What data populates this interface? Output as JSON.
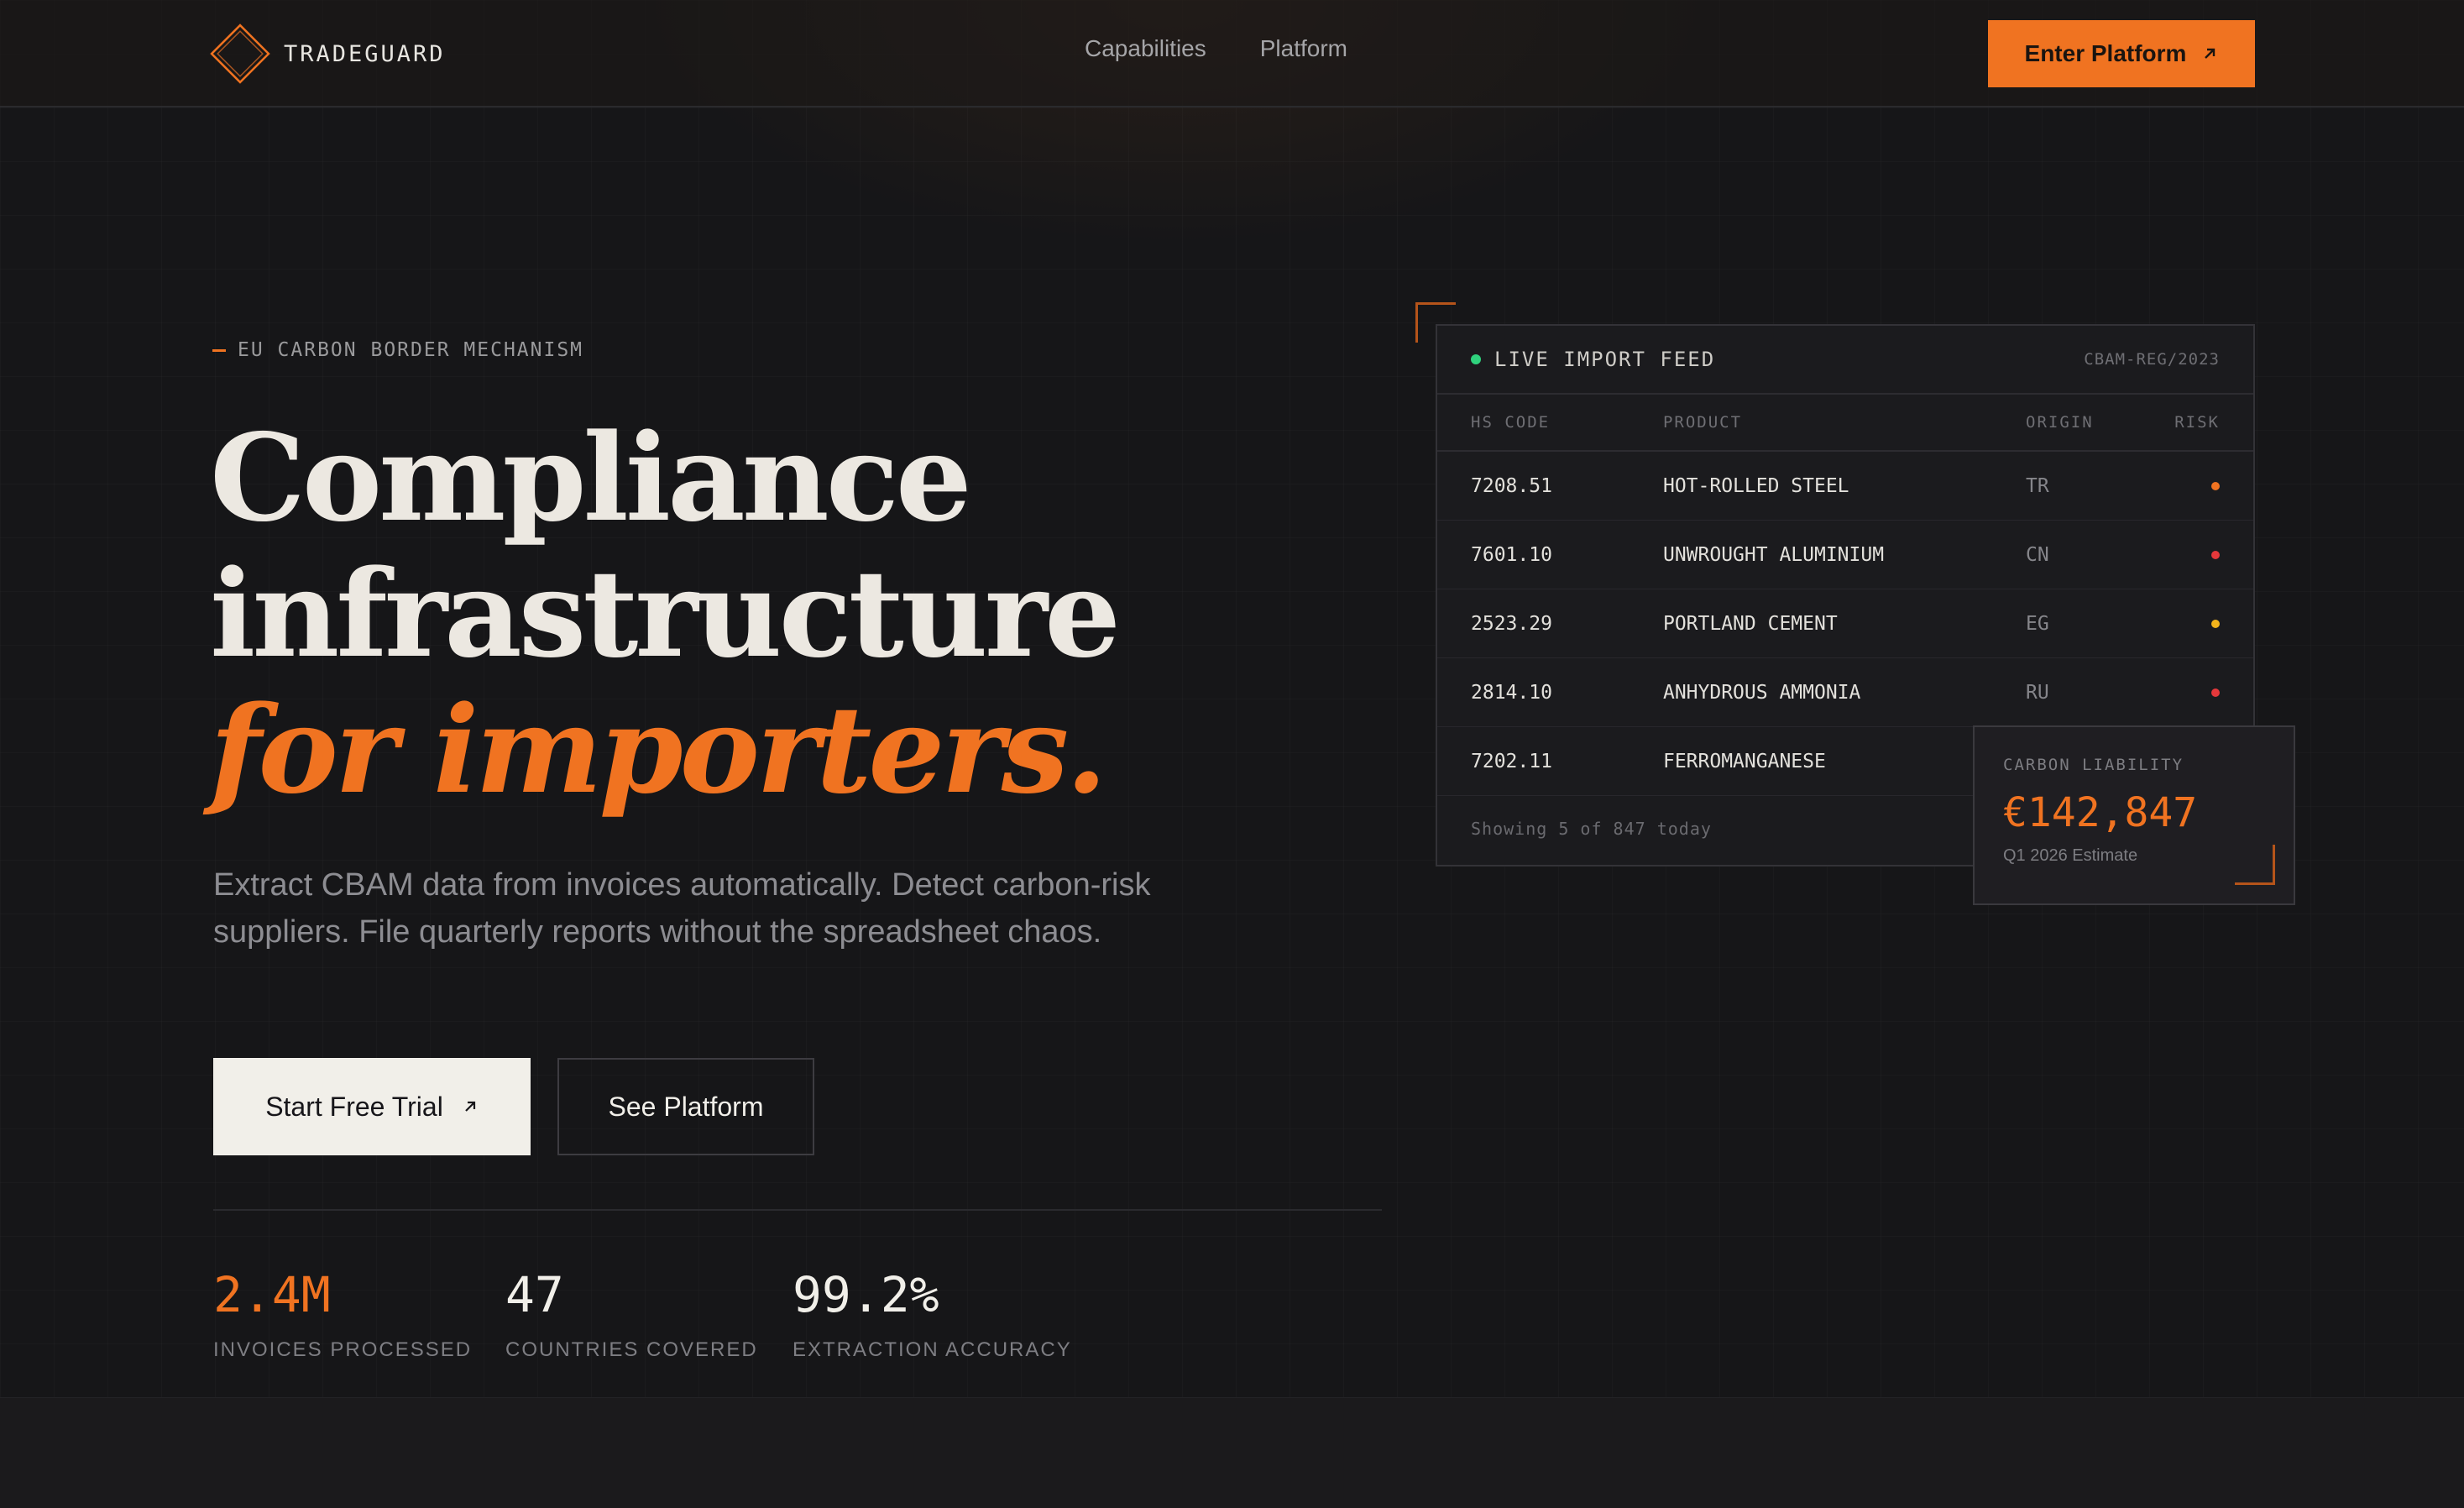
{
  "brand": {
    "name": "TRADEGUARD"
  },
  "nav": {
    "links": [
      "Capabilities",
      "Platform"
    ],
    "cta_label": "Enter Platform"
  },
  "hero": {
    "eyebrow": "EU CARBON BORDER MECHANISM",
    "headline_line1": "Compliance",
    "headline_line2": "infrastructure",
    "headline_accent": "for importers.",
    "subtitle": "Extract CBAM data from invoices automatically. Detect carbon-risk suppliers. File quarterly reports without the spreadsheet chaos.",
    "primary_cta": "Start Free Trial",
    "secondary_cta": "See Platform"
  },
  "stats": [
    {
      "value": "2.4M",
      "label": "INVOICES PROCESSED"
    },
    {
      "value": "47",
      "label": "COUNTRIES COVERED"
    },
    {
      "value": "99.2%",
      "label": "EXTRACTION ACCURACY"
    }
  ],
  "feed": {
    "title": "LIVE IMPORT FEED",
    "reg_code": "CBAM-REG/2023",
    "columns": {
      "hs": "HS CODE",
      "product": "PRODUCT",
      "origin": "ORIGIN",
      "risk": "RISK"
    },
    "rows": [
      {
        "hs": "7208.51",
        "product": "HOT-ROLLED STEEL",
        "origin": "TR",
        "risk_color": "#f07321"
      },
      {
        "hs": "7601.10",
        "product": "UNWROUGHT ALUMINIUM",
        "origin": "CN",
        "risk_color": "#e5383b"
      },
      {
        "hs": "2523.29",
        "product": "PORTLAND CEMENT",
        "origin": "EG",
        "risk_color": "#f2b31b"
      },
      {
        "hs": "2814.10",
        "product": "ANHYDROUS AMMONIA",
        "origin": "RU",
        "risk_color": "#e5383b"
      },
      {
        "hs": "7202.11",
        "product": "FERROMANGANESE",
        "origin": "",
        "risk_color": ""
      }
    ],
    "footer": "Showing 5 of 847 today"
  },
  "liability": {
    "label": "CARBON LIABILITY",
    "value": "€142,847",
    "sub": "Q1 2026 Estimate"
  },
  "colors": {
    "accent": "#f07321",
    "live": "#2fd27d"
  }
}
